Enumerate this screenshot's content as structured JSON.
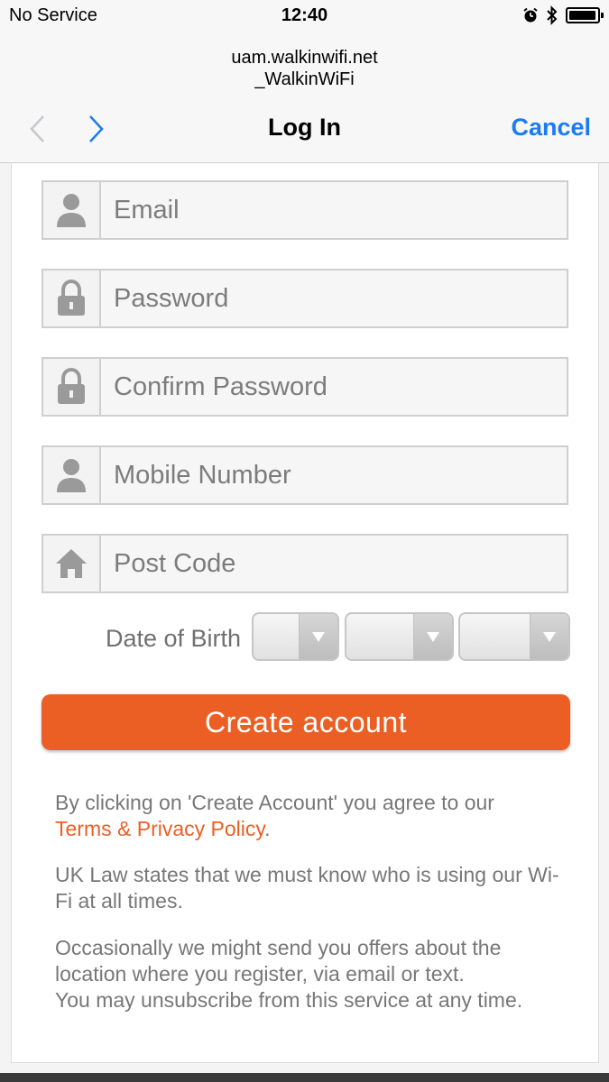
{
  "status_bar": {
    "carrier": "No Service",
    "time": "12:40"
  },
  "browser": {
    "url_line1": "uam.walkinwifi.net",
    "url_line2": "_WalkinWiFi"
  },
  "nav": {
    "title": "Log In",
    "cancel": "Cancel"
  },
  "form": {
    "email_placeholder": "Email",
    "password_placeholder": "Password",
    "confirm_password_placeholder": "Confirm Password",
    "mobile_placeholder": "Mobile Number",
    "postcode_placeholder": "Post Code",
    "dob_label": "Date of Birth",
    "create_button": "Create account"
  },
  "legal": {
    "agree_text": "By clicking on 'Create Account' you agree to our",
    "terms_link": "Terms & Privacy Policy",
    "terms_period": ".",
    "uk_law": "UK Law states that we must know who is using our Wi-Fi at all times.",
    "offers_line1": "Occasionally we might send you offers about the location where you register, via email or text.",
    "offers_line2": "You may unsubscribe from this service at any time."
  },
  "colors": {
    "accent": "#ec5f24",
    "link_blue": "#1a7cf2"
  },
  "icons": [
    "alarm-icon",
    "bluetooth-icon",
    "battery-icon",
    "back-chevron-icon",
    "forward-chevron-icon",
    "user-icon",
    "lock-icon",
    "home-icon",
    "dropdown-caret-icon"
  ]
}
